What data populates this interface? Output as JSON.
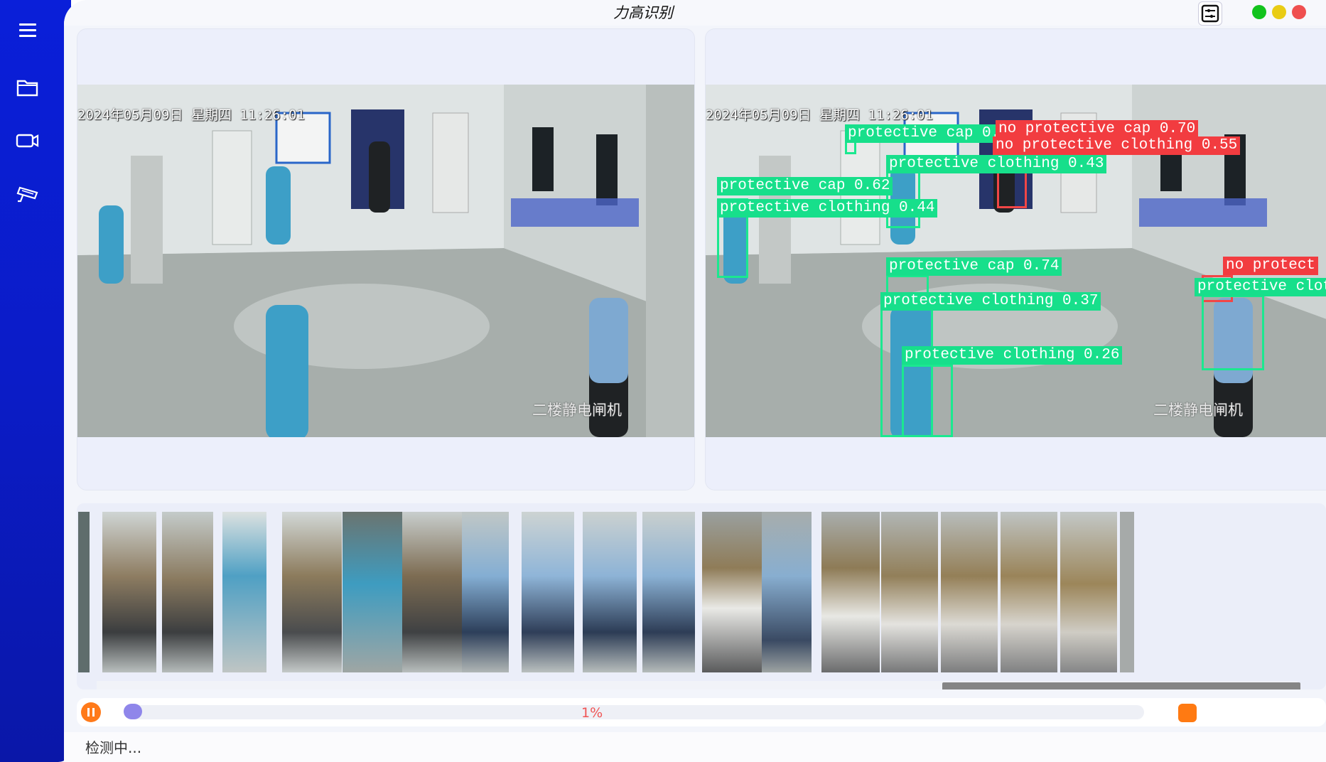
{
  "window": {
    "title": "力高识别"
  },
  "sidebar": {
    "items": [
      {
        "icon": "menu-icon"
      },
      {
        "icon": "folder-icon"
      },
      {
        "icon": "camera-icon"
      },
      {
        "icon": "cctv-icon"
      }
    ]
  },
  "colors": {
    "sidebar": "#0a1fd9",
    "detect_ok": "#17df8b",
    "detect_bad": "#f23c40",
    "accent": "#ff7a1a",
    "progress_knob": "#8f86ea"
  },
  "original_video": {
    "timestamp": "2024年05月09日 星期四 11:26:01",
    "location": "二楼静电闸机"
  },
  "result_video": {
    "timestamp": "2024年05月09日 星期四 11:26:01",
    "location": "二楼静电闸机",
    "detections": [
      {
        "label": "protective cap 0.6",
        "cls": "ok"
      },
      {
        "label": "no protective cap 0.70",
        "cls": "bad"
      },
      {
        "label": "protective cap 0.62",
        "cls": "ok"
      },
      {
        "label": "no protective clothing 0.55",
        "cls": "bad"
      },
      {
        "label": "protective clothing 0.43",
        "cls": "ok"
      },
      {
        "label": "protective clothing 0.44",
        "cls": "ok"
      },
      {
        "label": "protective cap 0.74",
        "cls": "ok"
      },
      {
        "label": "protective clothing 0.37",
        "cls": "ok"
      },
      {
        "label": "protective clothing 0.26",
        "cls": "ok"
      },
      {
        "label": "no protect",
        "cls": "bad"
      },
      {
        "label": "protective clot",
        "cls": "ok"
      }
    ]
  },
  "playback": {
    "progress_text": "1%",
    "progress": 0.01
  },
  "status": {
    "text": "检测中..."
  }
}
